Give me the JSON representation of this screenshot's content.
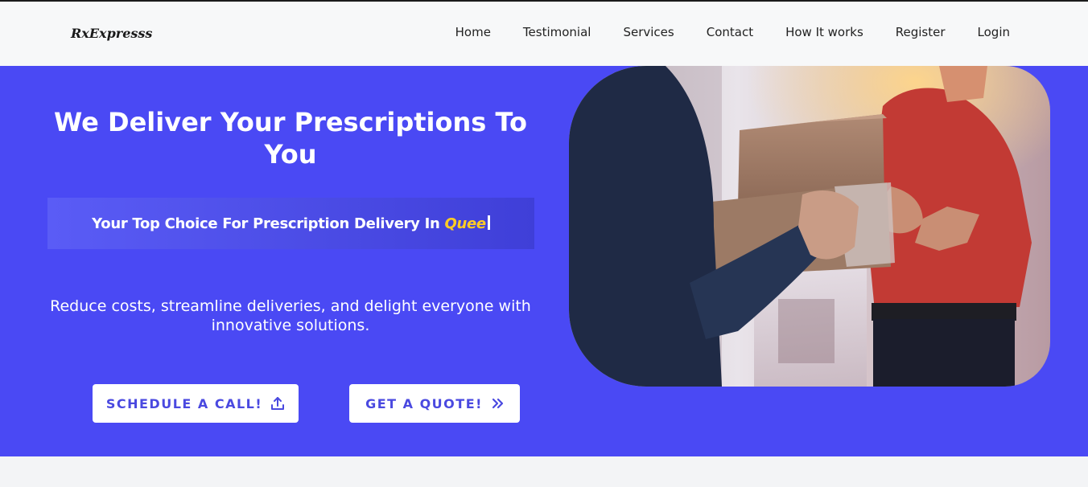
{
  "brand": {
    "name": "RxExpresss"
  },
  "nav": {
    "items": [
      {
        "label": "Home"
      },
      {
        "label": "Testimonial"
      },
      {
        "label": "Services"
      },
      {
        "label": "Contact"
      },
      {
        "label": "How It works"
      },
      {
        "label": "Register"
      },
      {
        "label": "Login"
      }
    ]
  },
  "hero": {
    "title": "We Deliver Your Prescriptions To You",
    "tagline_prefix": "Your Top Choice For Prescription Delivery In ",
    "tagline_typed": "Quee",
    "description": "Reduce costs, streamline deliveries, and delight everyone with innovative solutions.",
    "primary_button": {
      "label": "SCHEDULE A CALL!",
      "icon": "upload-icon"
    },
    "secondary_button": {
      "label": "GET A QUOTE!",
      "icon": "double-chevron-right-icon"
    },
    "image": {
      "subject": "delivery-person-handing-package-photo"
    }
  },
  "colors": {
    "hero_bg": "#4a49f4",
    "accent_yellow": "#ffcc24",
    "button_text": "#4a49e0",
    "navbar_bg": "#f7f8f9"
  }
}
